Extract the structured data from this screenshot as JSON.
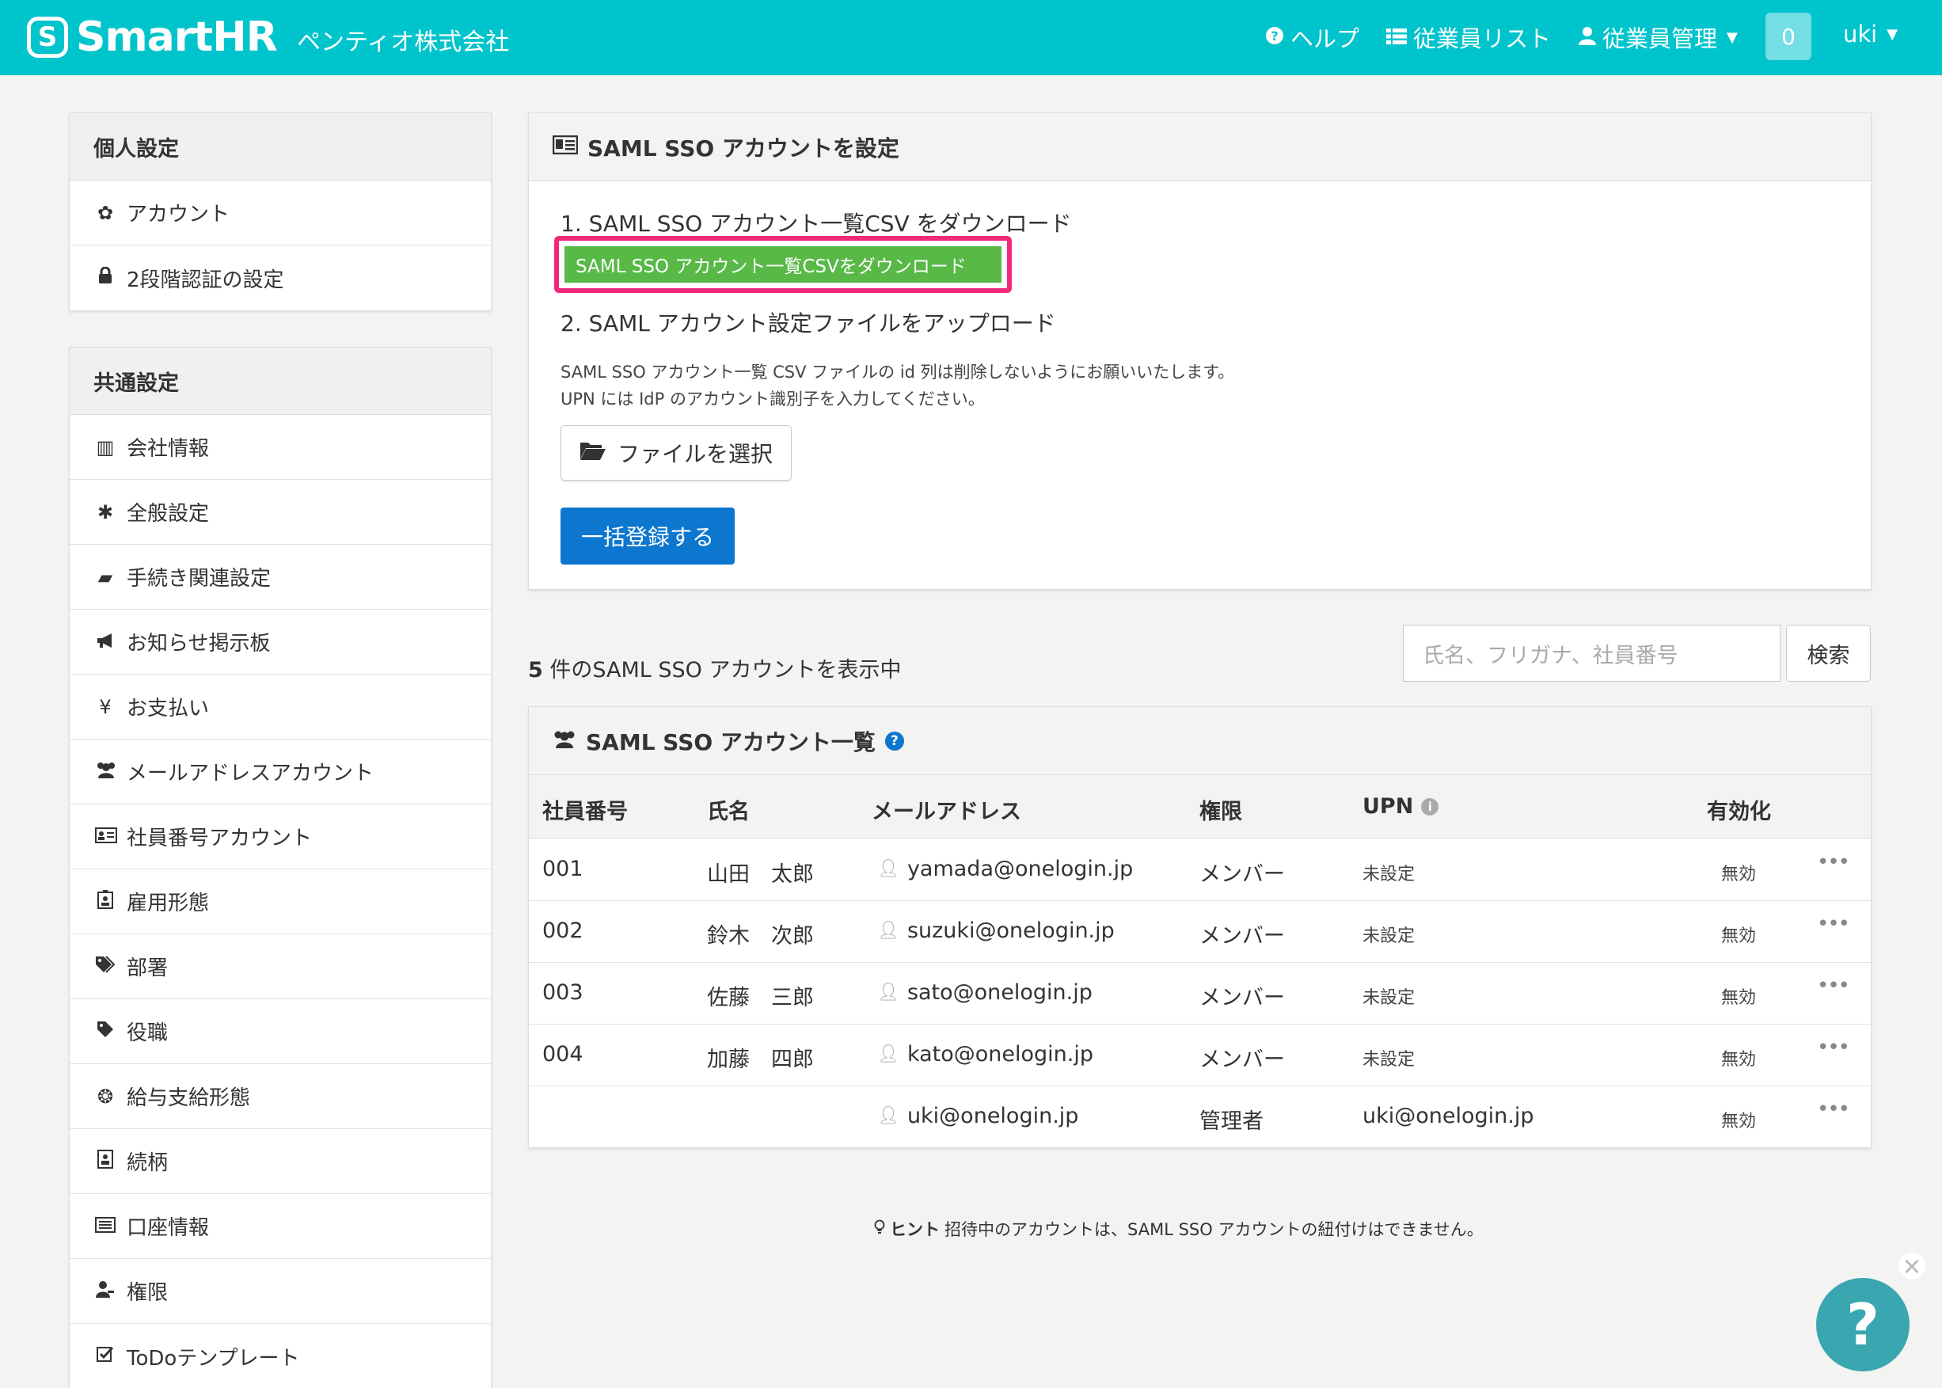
{
  "header": {
    "logo_mark": "S",
    "logo_text": "SmartHR",
    "company": "ペンティオ株式会社",
    "help": "ヘルプ",
    "employee_list": "従業員リスト",
    "employee_manage": "従業員管理",
    "notifications": "0",
    "user": "uki"
  },
  "sidebar": {
    "personal_title": "個人設定",
    "personal_items": [
      {
        "label": "アカウント",
        "icon": "gear-icon"
      },
      {
        "label": "2段階認証の設定",
        "icon": "lock-icon"
      }
    ],
    "common_title": "共通設定",
    "common_items": [
      {
        "label": "会社情報",
        "icon": "building-icon"
      },
      {
        "label": "全般設定",
        "icon": "asterisk-icon"
      },
      {
        "label": "手続き関連設定",
        "icon": "book-icon"
      },
      {
        "label": "お知らせ掲示板",
        "icon": "megaphone-icon"
      },
      {
        "label": "お支払い",
        "icon": "yen-icon"
      },
      {
        "label": "メールアドレスアカウント",
        "icon": "users-icon"
      },
      {
        "label": "社員番号アカウント",
        "icon": "id-card-icon"
      },
      {
        "label": "雇用形態",
        "icon": "badge-icon"
      },
      {
        "label": "部署",
        "icon": "tags-icon"
      },
      {
        "label": "役職",
        "icon": "tag-icon"
      },
      {
        "label": "給与支給形態",
        "icon": "money-icon"
      },
      {
        "label": "続柄",
        "icon": "contact-icon"
      },
      {
        "label": "口座情報",
        "icon": "list-icon"
      },
      {
        "label": "権限",
        "icon": "user-key-icon"
      },
      {
        "label": "ToDoテンプレート",
        "icon": "checkbox-icon"
      }
    ]
  },
  "setup": {
    "title": "SAML SSO アカウントを設定",
    "step1": "1. SAML SSO アカウント一覧CSV をダウンロード",
    "download_button": "SAML SSO アカウント一覧CSVをダウンロード",
    "step2": "2. SAML アカウント設定ファイルをアップロード",
    "note1": "SAML SSO アカウント一覧 CSV ファイルの id 列は削除しないようにお願いいたします。",
    "note2": "UPN には IdP のアカウント識別子を入力してください。",
    "file_button": "ファイルを選択",
    "submit_button": "一括登録する"
  },
  "list": {
    "count": "5",
    "count_suffix": " 件のSAML SSO アカウントを表示中",
    "search_placeholder": "氏名、フリガナ、社員番号",
    "search_button": "検索",
    "title": "SAML SSO アカウント一覧",
    "columns": [
      "社員番号",
      "氏名",
      "メールアドレス",
      "権限",
      "UPN",
      "有効化"
    ],
    "rows": [
      {
        "number": "001",
        "name": "山田　太郎",
        "email": "yamada@onelogin.jp",
        "role": "メンバー",
        "upn": "未設定",
        "active": "無効"
      },
      {
        "number": "002",
        "name": "鈴木　次郎",
        "email": "suzuki@onelogin.jp",
        "role": "メンバー",
        "upn": "未設定",
        "active": "無効"
      },
      {
        "number": "003",
        "name": "佐藤　三郎",
        "email": "sato@onelogin.jp",
        "role": "メンバー",
        "upn": "未設定",
        "active": "無効"
      },
      {
        "number": "004",
        "name": "加藤　四郎",
        "email": "kato@onelogin.jp",
        "role": "メンバー",
        "upn": "未設定",
        "active": "無効"
      },
      {
        "number": "",
        "name": "",
        "email": "uki@onelogin.jp",
        "role": "管理者",
        "upn": "uki@onelogin.jp",
        "active": "無効"
      }
    ]
  },
  "hint": {
    "label": "ヒント",
    "text": "招待中のアカウントは、SAML SSO アカウントの紐付けはできません。"
  },
  "help_widget": {
    "symbol": "?",
    "close": "×"
  },
  "colors": {
    "header": "#00c4cc",
    "download_button": "#58b947",
    "highlight_border": "#f0287a",
    "primary_button": "#0d76cf"
  }
}
